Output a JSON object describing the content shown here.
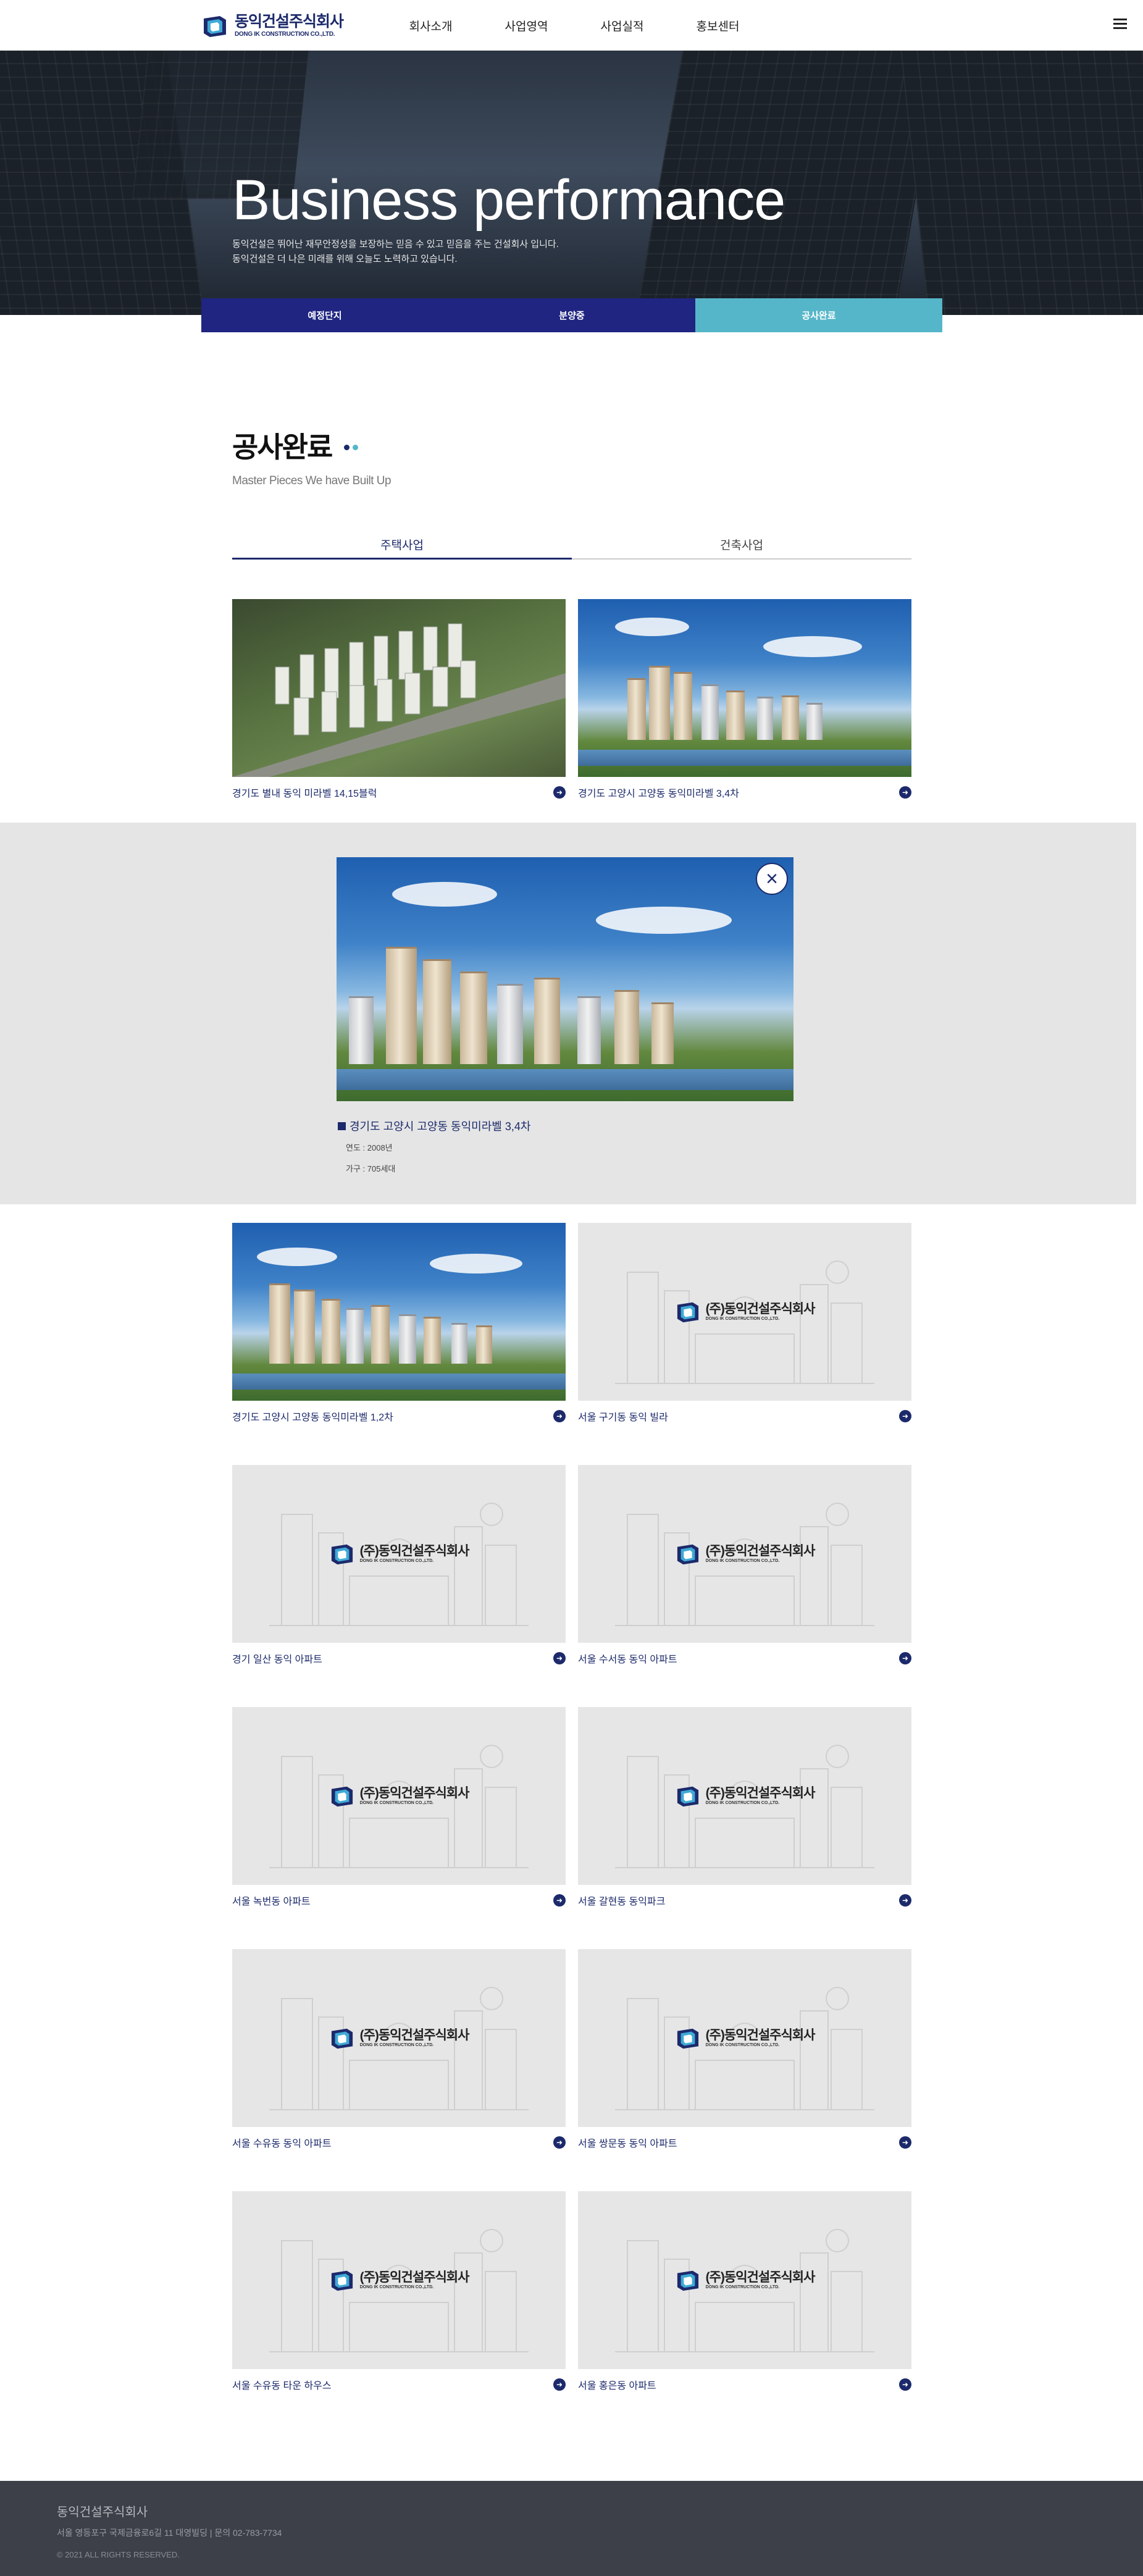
{
  "header": {
    "logo_kr": "동익건설주식회사",
    "logo_en": "DONG IK CONSTRUCTION CO.,LTD.",
    "nav": [
      "회사소개",
      "사업영역",
      "사업실적",
      "홍보센터"
    ],
    "brand_color": "#1c2a6b",
    "menu_icon": "hamburger-icon"
  },
  "hero": {
    "title": "Business performance",
    "desc_line1": "동익건설은 뛰어난 재무안정성을 보장하는 믿음 수 있고 믿음을 주는 건설회사 입니다.",
    "desc_line2": "동익건설은 더 나은 미래를 위해 오늘도 노력하고 있습니다."
  },
  "subtabs": {
    "items": [
      "예정단지",
      "분양중",
      "공사완료"
    ],
    "active_index": 2,
    "color": "#1f2581",
    "active_color": "#56b6c9"
  },
  "section": {
    "title": "공사완료",
    "subtitle": "Master Pieces We have Built Up",
    "dot_colors": [
      "#1c2a6b",
      "#56b6c9"
    ]
  },
  "category_tabs": {
    "items": [
      "주택사업",
      "건축사업"
    ],
    "active_index": 0
  },
  "projects": [
    {
      "title": "경기도 별내 동익 미라벨 14,15블럭"
    },
    {
      "title": "경기도 고양시 고양동 동익미라벨 3,4차"
    },
    {
      "title": "경기도 고양시 고양동 동익미라벨 1,2차"
    },
    {
      "title": "서울 구기동 동익 빌라"
    },
    {
      "title": "경기 일산 동익 아파트"
    },
    {
      "title": "서울 수서동 동익 아파트"
    },
    {
      "title": "서울 녹번동 아파트"
    },
    {
      "title": "서울 갈현동 동익파크"
    },
    {
      "title": "서울 수유동 동익 아파트"
    },
    {
      "title": "서울 쌍문동 동익 아파트"
    },
    {
      "title": "서울 수유동 타운 하우스"
    },
    {
      "title": "서울 홍은동 아파트"
    }
  ],
  "placeholder": {
    "logo_kr": "(주)동익건설주식회사",
    "logo_en": "DONG IK CONSTRUCTION CO.,LTD."
  },
  "popup": {
    "title": "경기도 고양시 고양동 동익미라벨 3,4차",
    "year": "연도 : 2008년",
    "households": "가구 : 705세대"
  },
  "footer": {
    "company": "동익건설주식회사",
    "address": "서울 영등포구 국제금융로6길 11 대영빌딩  |   문의 02-783-7734",
    "copyright": "© 2021 ALL RIGHTS RESERVED."
  }
}
